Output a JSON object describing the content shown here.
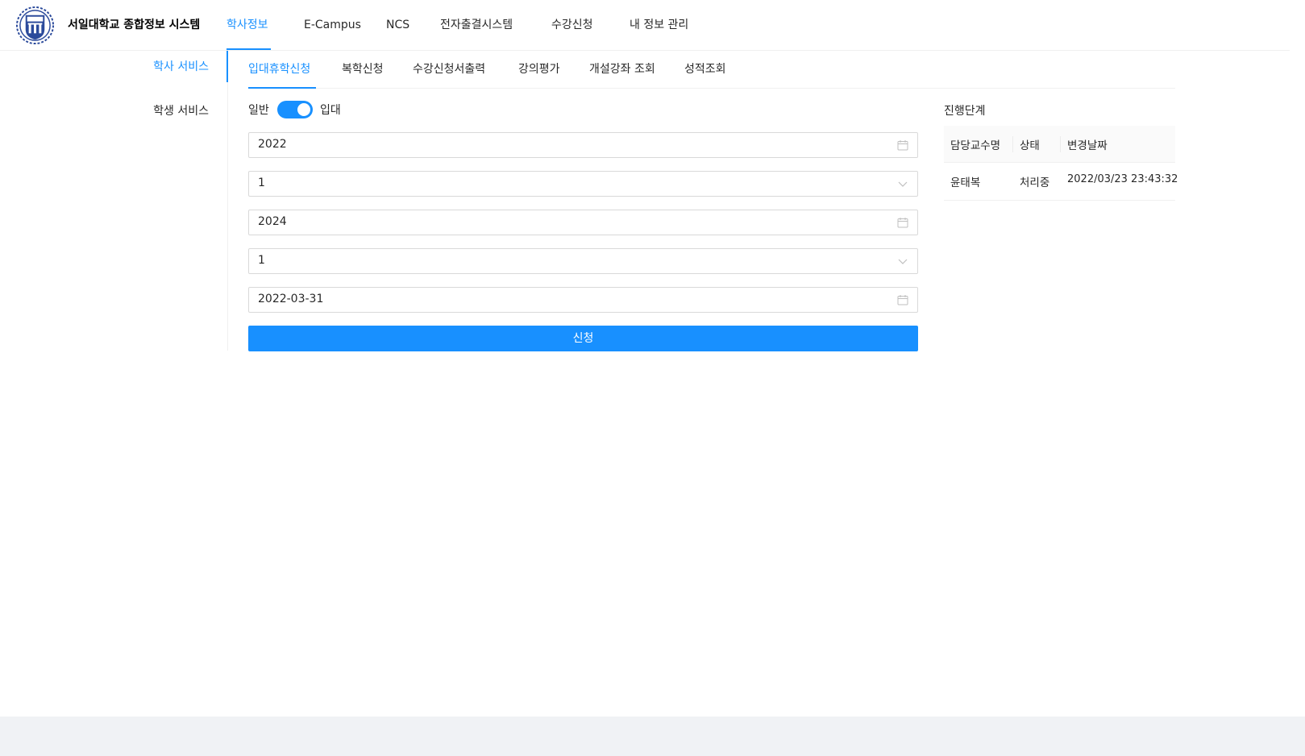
{
  "header": {
    "site_title": "서일대학교 종합정보 시스템",
    "nav": [
      {
        "label": "학사정보"
      },
      {
        "label": "E-Campus"
      },
      {
        "label": "NCS"
      },
      {
        "label": "전자출결시스템"
      },
      {
        "label": "수강신청"
      },
      {
        "label": "내 정보 관리"
      }
    ],
    "active_nav": "학사정보"
  },
  "sidebar": {
    "items": [
      {
        "label": "학사 서비스"
      },
      {
        "label": "학생 서비스"
      }
    ],
    "active_item": "학사 서비스"
  },
  "tabs": {
    "items": [
      {
        "label": "입대휴학신청"
      },
      {
        "label": "복학신청"
      },
      {
        "label": "수강신청서출력"
      },
      {
        "label": "강의평가"
      },
      {
        "label": "개설강좌 조회"
      },
      {
        "label": "성적조회"
      }
    ],
    "active_tab": "입대휴학신청"
  },
  "form": {
    "toggle": {
      "left_label": "일반",
      "right_label": "입대",
      "checked": true
    },
    "fields": [
      {
        "value": "2022",
        "icon": "calendar-icon"
      },
      {
        "value": "1",
        "icon": "chevron-down-icon"
      },
      {
        "value": "2024",
        "icon": "calendar-icon"
      },
      {
        "value": "1",
        "icon": "chevron-down-icon"
      },
      {
        "value": "2022-03-31",
        "icon": "calendar-icon"
      }
    ],
    "submit_label": "신청"
  },
  "progress": {
    "title": "진행단계",
    "columns": [
      "담당교수명",
      "상태",
      "변경날짜"
    ],
    "rows": [
      {
        "professor": "윤태복",
        "status": "처리중",
        "date": "2022/03/23 23:43:32"
      }
    ]
  },
  "colors": {
    "primary": "#1890ff",
    "footer_background": "#f0f2f5"
  }
}
